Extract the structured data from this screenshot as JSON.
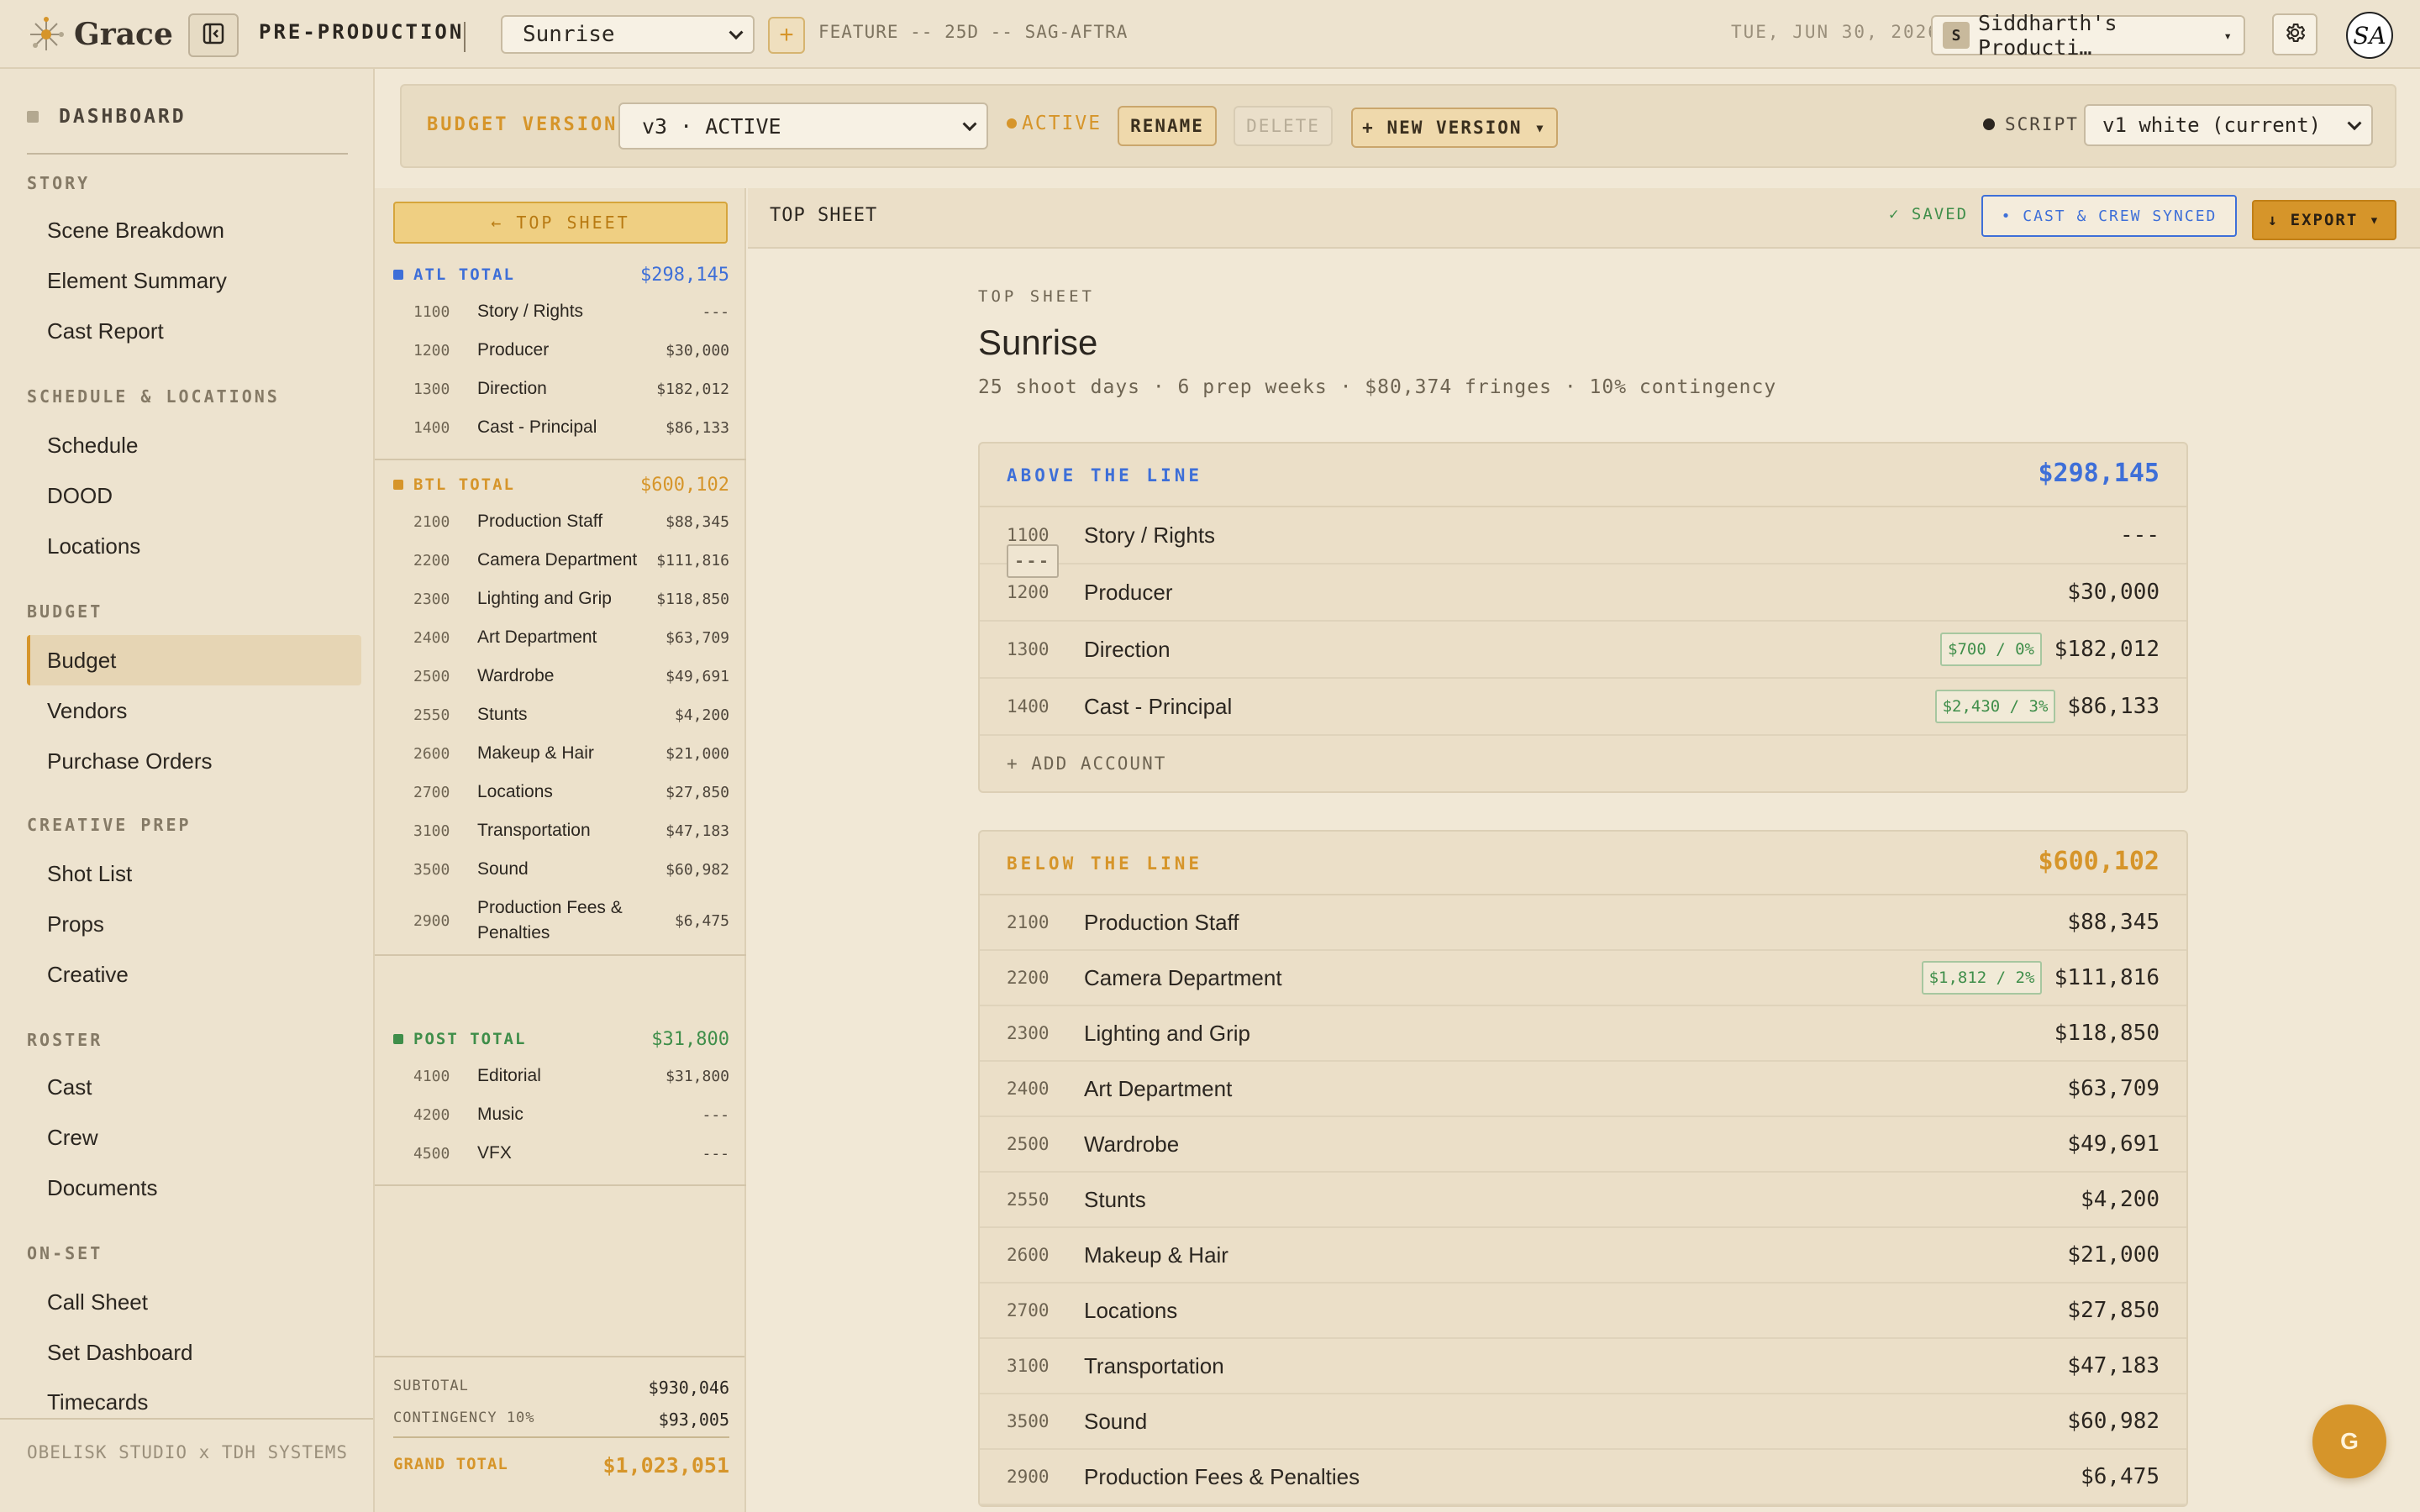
{
  "app": {
    "name": "Grace",
    "phase": "PRE-PRODUCTION",
    "project": "Sunrise",
    "project_meta": "FEATURE -- 25D -- SAG-AFTRA",
    "date": "TUE, JUN 30, 2026",
    "company": "Siddharth's Producti…",
    "company_initial": "S",
    "user_initials": "SA",
    "add_label": "+",
    "fab_label": "G"
  },
  "nav": {
    "dashboard": "DASHBOARD",
    "sections": [
      {
        "title": "STORY",
        "items": [
          "Scene Breakdown",
          "Element Summary",
          "Cast Report"
        ]
      },
      {
        "title": "SCHEDULE & LOCATIONS",
        "items": [
          "Schedule",
          "DOOD",
          "Locations"
        ]
      },
      {
        "title": "BUDGET",
        "items": [
          "Budget",
          "Vendors",
          "Purchase Orders"
        ]
      },
      {
        "title": "CREATIVE PREP",
        "items": [
          "Shot List",
          "Props",
          "Creative"
        ]
      },
      {
        "title": "ROSTER",
        "items": [
          "Cast",
          "Crew",
          "Documents"
        ]
      },
      {
        "title": "ON-SET",
        "items": [
          "Call Sheet",
          "Set Dashboard",
          "Timecards"
        ]
      }
    ],
    "active": "Budget",
    "footer": "OBELISK STUDIO x TDH SYSTEMS"
  },
  "version_bar": {
    "label": "BUDGET VERSION",
    "selected": "v3 · ACTIVE",
    "status": "ACTIVE",
    "rename": "RENAME",
    "delete": "DELETE",
    "new_version": "+ NEW VERSION ▾",
    "script_label": "SCRIPT",
    "script_selected": "v1 white (current)"
  },
  "accounts_panel": {
    "top_sheet_btn": "← TOP SHEET",
    "groups": [
      {
        "label": "ATL TOTAL",
        "total": "$298,145",
        "color": "#3e6fd8",
        "rows": [
          {
            "code": "1100",
            "name": "Story / Rights",
            "amount": "---"
          },
          {
            "code": "1200",
            "name": "Producer",
            "amount": "$30,000"
          },
          {
            "code": "1300",
            "name": "Direction",
            "amount": "$182,012"
          },
          {
            "code": "1400",
            "name": "Cast - Principal",
            "amount": "$86,133"
          }
        ]
      },
      {
        "label": "BTL TOTAL",
        "total": "$600,102",
        "color": "#d6952a",
        "rows": [
          {
            "code": "2100",
            "name": "Production Staff",
            "amount": "$88,345"
          },
          {
            "code": "2200",
            "name": "Camera Department",
            "amount": "$111,816"
          },
          {
            "code": "2300",
            "name": "Lighting and Grip",
            "amount": "$118,850"
          },
          {
            "code": "2400",
            "name": "Art Department",
            "amount": "$63,709"
          },
          {
            "code": "2500",
            "name": "Wardrobe",
            "amount": "$49,691"
          },
          {
            "code": "2550",
            "name": "Stunts",
            "amount": "$4,200"
          },
          {
            "code": "2600",
            "name": "Makeup & Hair",
            "amount": "$21,000"
          },
          {
            "code": "2700",
            "name": "Locations",
            "amount": "$27,850"
          },
          {
            "code": "3100",
            "name": "Transportation",
            "amount": "$47,183"
          },
          {
            "code": "3500",
            "name": "Sound",
            "amount": "$60,982"
          },
          {
            "code": "2900",
            "name": "Production Fees & Penalties",
            "amount": "$6,475"
          }
        ]
      },
      {
        "label": "POST TOTAL",
        "total": "$31,800",
        "color": "#3f8e4a",
        "rows": [
          {
            "code": "4100",
            "name": "Editorial",
            "amount": "$31,800"
          },
          {
            "code": "4200",
            "name": "Music",
            "amount": "---"
          },
          {
            "code": "4500",
            "name": "VFX",
            "amount": "---"
          }
        ]
      }
    ],
    "subtotal_label": "SUBTOTAL",
    "subtotal": "$930,046",
    "contingency_label": "CONTINGENCY 10%",
    "contingency": "$93,005",
    "grand_total_label": "GRAND TOTAL",
    "grand_total": "$1,023,051"
  },
  "main": {
    "header_title": "TOP SHEET",
    "saved": "✓ SAVED",
    "synced": "• CAST & CREW SYNCED",
    "export": "↓ EXPORT ▾",
    "label": "TOP SHEET",
    "title": "Sunrise",
    "subtitle": "25 shoot days · 6 prep weeks · $80,374 fringes · 10% contingency",
    "above": {
      "title": "ABOVE THE LINE",
      "total": "$298,145",
      "color": "#3e6fd8",
      "rows": [
        {
          "code": "1100",
          "name": "Story / Rights",
          "amount": "---",
          "tag": "---",
          "tag_type": "dash"
        },
        {
          "code": "1200",
          "name": "Producer",
          "amount": "$30,000"
        },
        {
          "code": "1300",
          "name": "Direction",
          "amount": "$182,012",
          "tag": "$700 / 0%",
          "tag_type": "fringe"
        },
        {
          "code": "1400",
          "name": "Cast - Principal",
          "amount": "$86,133",
          "tag": "$2,430 / 3%",
          "tag_type": "fringe"
        }
      ],
      "add_label": "+  ADD ACCOUNT"
    },
    "below": {
      "title": "BELOW THE LINE",
      "total": "$600,102",
      "color": "#d6952a",
      "rows": [
        {
          "code": "2100",
          "name": "Production Staff",
          "amount": "$88,345"
        },
        {
          "code": "2200",
          "name": "Camera Department",
          "amount": "$111,816",
          "tag": "$1,812 / 2%",
          "tag_type": "fringe"
        },
        {
          "code": "2300",
          "name": "Lighting and Grip",
          "amount": "$118,850"
        },
        {
          "code": "2400",
          "name": "Art Department",
          "amount": "$63,709"
        },
        {
          "code": "2500",
          "name": "Wardrobe",
          "amount": "$49,691"
        },
        {
          "code": "2550",
          "name": "Stunts",
          "amount": "$4,200"
        },
        {
          "code": "2600",
          "name": "Makeup & Hair",
          "amount": "$21,000"
        },
        {
          "code": "2700",
          "name": "Locations",
          "amount": "$27,850"
        },
        {
          "code": "3100",
          "name": "Transportation",
          "amount": "$47,183"
        },
        {
          "code": "3500",
          "name": "Sound",
          "amount": "$60,982"
        },
        {
          "code": "2900",
          "name": "Production Fees & Penalties",
          "amount": "$6,475"
        }
      ]
    }
  }
}
